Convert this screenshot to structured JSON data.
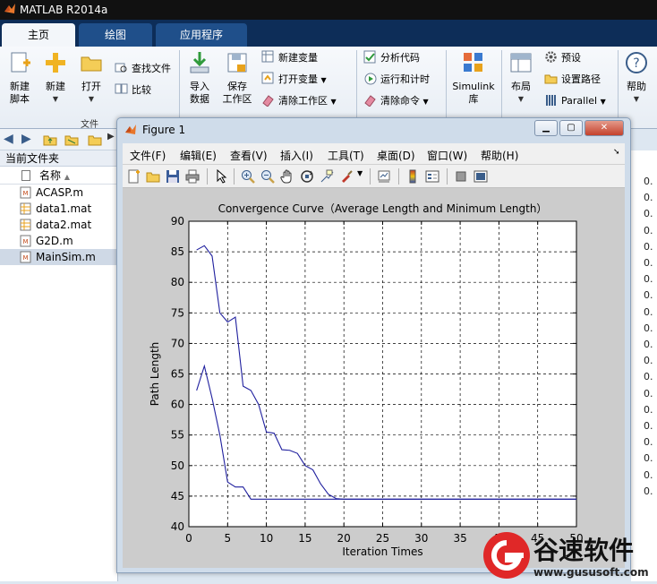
{
  "app": {
    "title": "MATLAB R2014a"
  },
  "ribbon_tabs": [
    {
      "label": "主页",
      "active": true
    },
    {
      "label": "绘图",
      "active": false
    },
    {
      "label": "应用程序",
      "active": false
    }
  ],
  "ribbon": {
    "new_script": "新建\n脚本",
    "new": "新建",
    "open": "打开",
    "find_files": "查找文件",
    "compare": "比较",
    "file_section": "文件",
    "import_data": "导入\n数据",
    "save_workspace": "保存\n工作区",
    "new_variable": "新建变量",
    "open_variable": "打开变量",
    "clear_workspace": "清除工作区",
    "analyze_code": "分析代码",
    "run_and_time": "运行和计时",
    "clear_commands": "清除命令",
    "simulink": "Simulink\n库",
    "layout": "布局",
    "preferences": "预设",
    "set_path": "设置路径",
    "parallel": "Parallel",
    "help": "帮助"
  },
  "file_browser": {
    "title": "当前文件夹",
    "column_name": "名称",
    "files": [
      {
        "name": "ACASP.m",
        "icon": "m-file-icon"
      },
      {
        "name": "data1.mat",
        "icon": "mat-file-icon"
      },
      {
        "name": "data2.mat",
        "icon": "mat-file-icon"
      },
      {
        "name": "G2D.m",
        "icon": "m-file-icon"
      },
      {
        "name": "MainSim.m",
        "icon": "m-file-icon",
        "selected": true
      }
    ]
  },
  "right_values": [
    "0.",
    "0.",
    "0.",
    "0.",
    "0.",
    "0.",
    "0.",
    "0.",
    "0.",
    "0.",
    "0.",
    "0.",
    "0.",
    "0.",
    "0.",
    "0.",
    "0.",
    "0.",
    "0.",
    "0."
  ],
  "figure": {
    "title": "Figure 1",
    "menu": [
      "文件(F)",
      "编辑(E)",
      "查看(V)",
      "插入(I)",
      "工具(T)",
      "桌面(D)",
      "窗口(W)",
      "帮助(H)"
    ],
    "toolbar_icons": [
      "new-figure-icon",
      "open-file-icon",
      "save-icon",
      "print-icon",
      "select-arrow-icon",
      "zoom-in-icon",
      "zoom-out-icon",
      "pan-hand-icon",
      "rotate-3d-icon",
      "data-cursor-icon",
      "brush-icon",
      "link-plot-icon",
      "colorbar-icon",
      "legend-icon",
      "hide-plot-tools-icon",
      "show-plot-tools-icon"
    ]
  },
  "chart_data": {
    "type": "line",
    "title": "Convergence Curve（Average Length and Minimum Length）",
    "xlabel": "Iteration Times",
    "ylabel": "Path Length",
    "xlim": [
      0,
      50
    ],
    "ylim": [
      40,
      90
    ],
    "xticks": [
      0,
      5,
      10,
      15,
      20,
      25,
      30,
      35,
      40,
      45,
      50
    ],
    "yticks": [
      40,
      45,
      50,
      55,
      60,
      65,
      70,
      75,
      80,
      85,
      90
    ],
    "grid": true,
    "series_color": "#1f1f9e",
    "series": [
      {
        "x": [
          1,
          2,
          3,
          4,
          5,
          6,
          7,
          8,
          9,
          10,
          11,
          12,
          13,
          14,
          15,
          16,
          17,
          18,
          19,
          20,
          25,
          30,
          35,
          40,
          45,
          50
        ],
        "y": [
          85.3,
          86.0,
          84.3,
          75.0,
          73.5,
          74.3,
          63.0,
          62.3,
          60.0,
          55.5,
          55.3,
          52.6,
          52.5,
          52.0,
          50.0,
          49.3,
          47.0,
          45.3,
          44.6,
          44.5,
          44.5,
          44.5,
          44.5,
          44.5,
          44.5,
          44.5
        ]
      },
      {
        "x": [
          1,
          2,
          3,
          4,
          5,
          6,
          7,
          8,
          10,
          15,
          20,
          25,
          30,
          35,
          40,
          45,
          50
        ],
        "y": [
          62.3,
          66.3,
          61.0,
          55.0,
          47.3,
          46.5,
          46.5,
          44.5,
          44.5,
          44.5,
          44.5,
          44.5,
          44.5,
          44.5,
          44.5,
          44.5,
          44.5
        ]
      }
    ]
  },
  "watermark": {
    "brand": "谷速软件",
    "url": "www.gususoft.com"
  }
}
